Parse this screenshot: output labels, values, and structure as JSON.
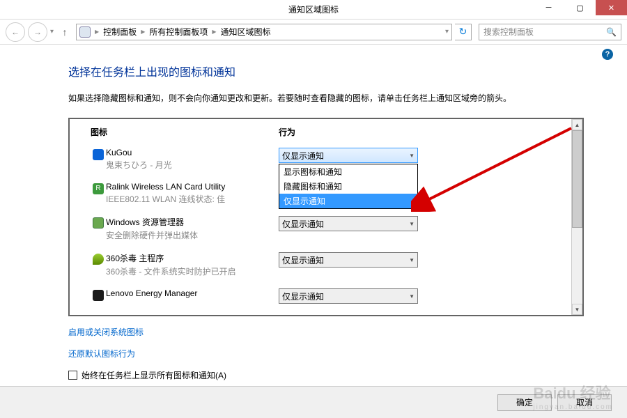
{
  "titlebar": {
    "title": "通知区域图标"
  },
  "nav": {
    "breadcrumb": [
      "控制面板",
      "所有控制面板项",
      "通知区域图标"
    ],
    "search_placeholder": "搜索控制面板"
  },
  "heading": "选择在任务栏上出现的图标和通知",
  "desc": "如果选择隐藏图标和通知，则不会向你通知更改和更新。若要随时查看隐藏的图标，请单击任务栏上通知区域旁的箭头。",
  "columns": {
    "icon": "图标",
    "behavior": "行为"
  },
  "select_options": [
    "显示图标和通知",
    "隐藏图标和通知",
    "仅显示通知"
  ],
  "items": [
    {
      "name": "KuGou",
      "sub": "鬼束ちひろ - 月光",
      "value": "仅显示通知",
      "open": true
    },
    {
      "name": "Ralink Wireless LAN Card Utility",
      "sub": "IEEE802.11 WLAN 连线状态: 佳",
      "value": ""
    },
    {
      "name": "Windows 资源管理器",
      "sub": "安全删除硬件并弹出媒体",
      "value": "仅显示通知"
    },
    {
      "name": "360杀毒 主程序",
      "sub": "360杀毒 - 文件系统实时防护已开启",
      "value": "仅显示通知"
    },
    {
      "name": "Lenovo Energy Manager",
      "sub": "",
      "value": "仅显示通知"
    }
  ],
  "links": {
    "toggle_system": "启用或关闭系统图标",
    "restore": "还原默认图标行为"
  },
  "checkbox_label": "始终在任务栏上显示所有图标和通知(A)",
  "footer": {
    "ok": "确定",
    "cancel": "取消"
  },
  "watermark": {
    "main": "Baidu 经验",
    "sub": "jingyan.baidu.com"
  }
}
